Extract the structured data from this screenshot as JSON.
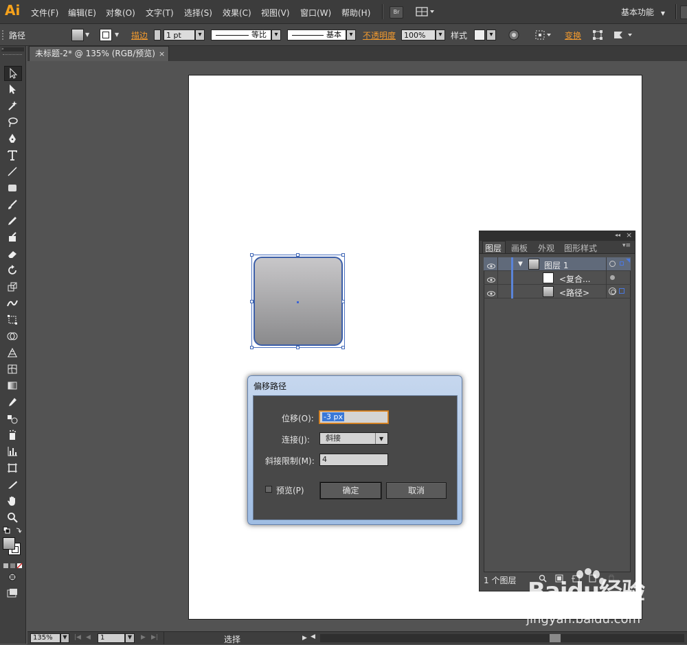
{
  "app": {
    "logo": "Ai",
    "menu": [
      "文件(F)",
      "编辑(E)",
      "对象(O)",
      "文字(T)",
      "选择(S)",
      "效果(C)",
      "视图(V)",
      "窗口(W)",
      "帮助(H)"
    ],
    "bridge_label": "Br",
    "workspace": "基本功能"
  },
  "control_bar": {
    "selection_type": "路径",
    "stroke_label": "描边",
    "stroke_weight": "1 pt",
    "profile_uniform": "等比",
    "brush_basic": "基本",
    "opacity_label": "不透明度",
    "opacity_value": "100%",
    "style_label": "样式",
    "transform_label": "变换"
  },
  "document": {
    "tab_title": "未标题-2* @ 135% (RGB/预览)",
    "close_symbol": "×"
  },
  "layers_panel": {
    "tabs": [
      "图层",
      "画板",
      "外观",
      "图形样式"
    ],
    "rows": [
      {
        "name": "图层 1",
        "expanded": true
      },
      {
        "name": "<复合...",
        "expanded": false
      },
      {
        "name": "<路径>",
        "expanded": false
      }
    ],
    "footer": "1 个图层"
  },
  "dialog": {
    "title": "偏移路径",
    "offset_label": "位移(O):",
    "offset_value": "-3 px",
    "joins_label": "连接(J):",
    "joins_value": "斜接",
    "miter_label": "斜接限制(M):",
    "miter_value": "4",
    "preview_label": "预览(P)",
    "preview_checked": false,
    "ok_label": "确定",
    "cancel_label": "取消"
  },
  "status_bar": {
    "zoom": "135%",
    "artboard_index": "1",
    "tool_status": "选择"
  },
  "watermark": {
    "brand": "Baidu经验",
    "url": "jingyan.baidu.com"
  },
  "colors": {
    "accent_orange": "#f29a2e",
    "selection_blue": "#3b5ea8",
    "dialog_frame": "#b4cbe9"
  }
}
